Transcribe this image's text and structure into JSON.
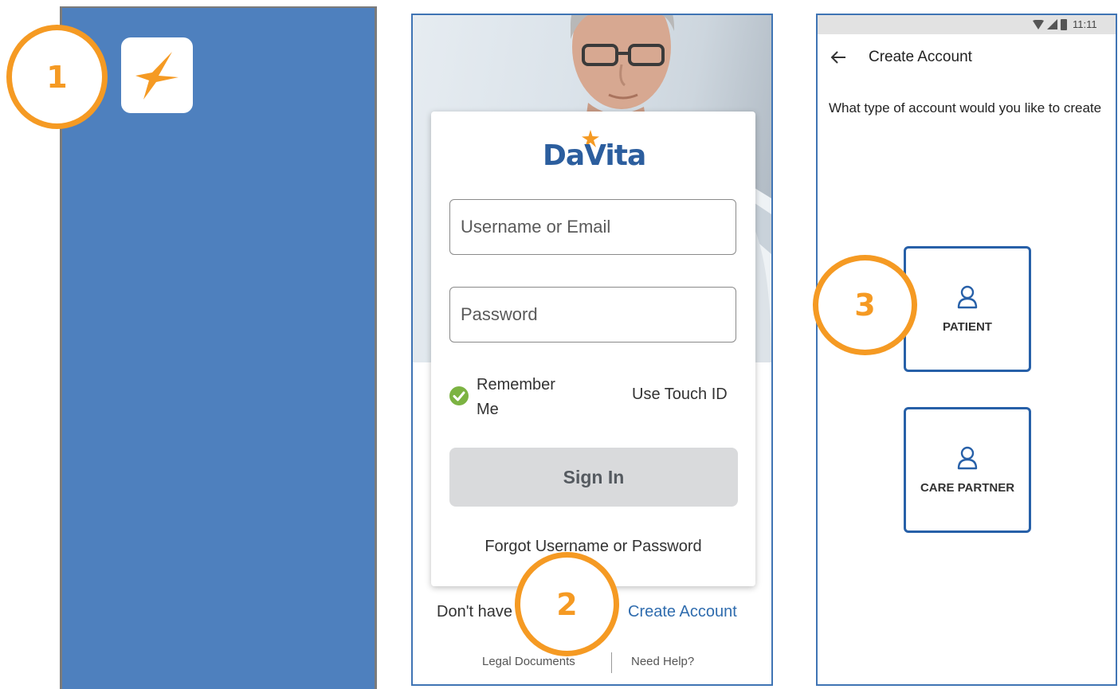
{
  "steps": [
    {
      "number": "1"
    },
    {
      "number": "2"
    },
    {
      "number": "3"
    }
  ],
  "screen1": {
    "icon": "davita-star-icon",
    "background_color": "#4e80be"
  },
  "screen2": {
    "logo_text": "DaVita",
    "username_placeholder": "Username or Email",
    "password_placeholder": "Password",
    "remember_label": "Remember Me",
    "touch_id_label": "Use Touch ID",
    "sign_in_label": "Sign In",
    "forgot_label": "Forgot Username or Password",
    "no_account_text": "Don't have an account?",
    "create_account_label": "Create Account",
    "legal_label": "Legal Documents",
    "help_label": "Need Help?"
  },
  "screen3": {
    "status_time": "11:11",
    "title": "Create Account",
    "prompt": "What type of account would you like to create",
    "options": [
      {
        "label": "PATIENT",
        "icon": "person-icon"
      },
      {
        "label": "CARE PARTNER",
        "icon": "person-icon"
      }
    ]
  },
  "colors": {
    "accent_orange": "#f59a23",
    "link_blue": "#2f6cae",
    "card_border_blue": "#2760a8",
    "check_green": "#7cb342"
  }
}
